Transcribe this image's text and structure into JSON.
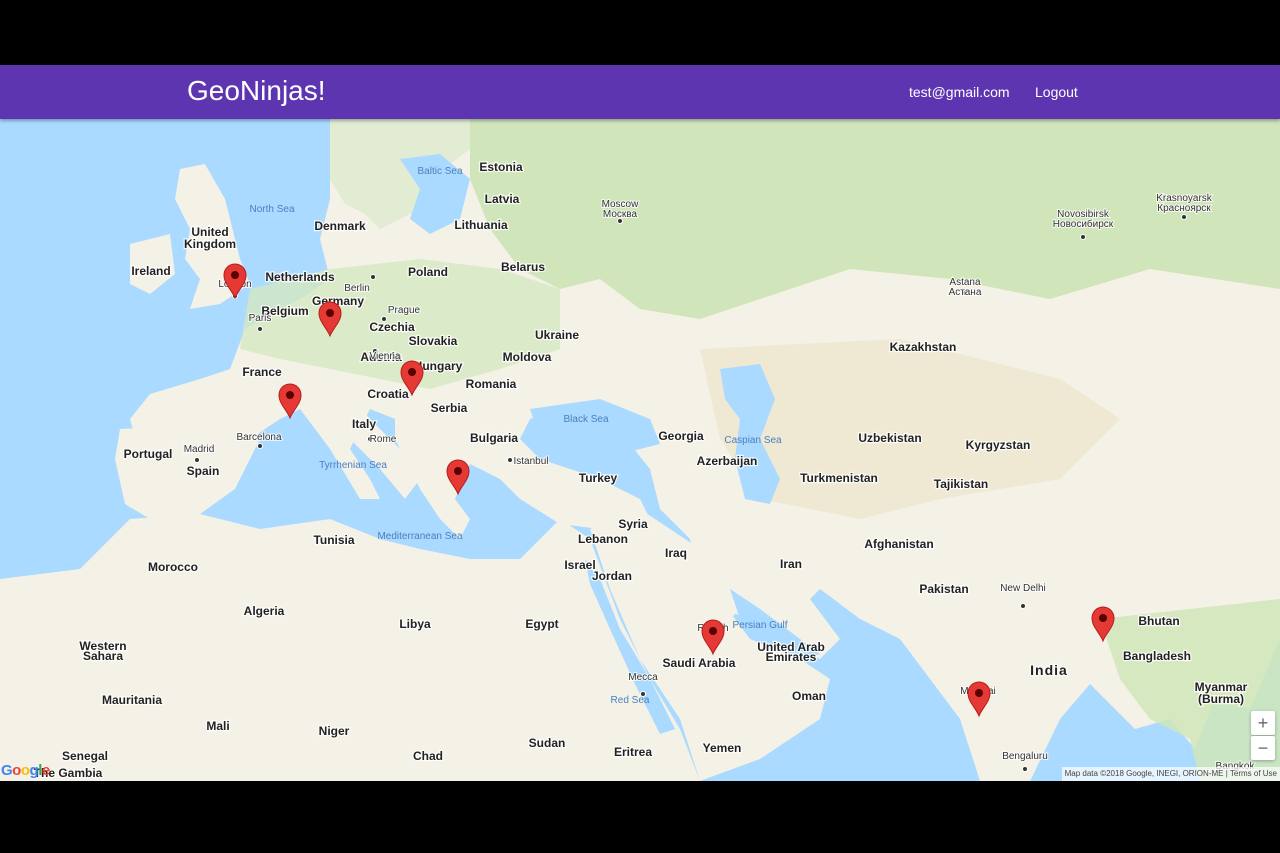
{
  "navbar": {
    "brand": "GeoNinjas!",
    "user_email": "test@gmail.com",
    "logout_label": "Logout",
    "color": "#5e35b1"
  },
  "map": {
    "water_color": "#aadaff",
    "land_color": "#f4f1e6",
    "forest_color": "#c9e3b2",
    "countries": [
      "United Kingdom",
      "Ireland",
      "Netherlands",
      "Belgium",
      "Germany",
      "Czechia",
      "Slovakia",
      "Austria",
      "Hungary",
      "Croatia",
      "Serbia",
      "Romania",
      "Moldova",
      "Bulgaria",
      "France",
      "Italy",
      "Spain",
      "Portugal",
      "Denmark",
      "Poland",
      "Estonia",
      "Latvia",
      "Lithuania",
      "Belarus",
      "Ukraine",
      "Georgia",
      "Azerbaijan",
      "Turkey",
      "Syria",
      "Lebanon",
      "Israel",
      "Jordan",
      "Iraq",
      "Iran",
      "Kazakhstan",
      "Uzbekistan",
      "Kyrgyzstan",
      "Turkmenistan",
      "Tajikistan",
      "Afghanistan",
      "Pakistan",
      "India",
      "Bhutan",
      "Bangladesh",
      "Myanmar (Burma)",
      "Saudi Arabia",
      "United Arab Emirates",
      "Oman",
      "Yemen",
      "Egypt",
      "Libya",
      "Algeria",
      "Tunisia",
      "Morocco",
      "Western Sahara",
      "Mauritania",
      "Mali",
      "Niger",
      "Chad",
      "Sudan",
      "Eritrea",
      "Senegal",
      "The Gambia"
    ],
    "cities": [
      "London",
      "Paris",
      "Berlin",
      "Prague",
      "Vienna",
      "Rome",
      "Madrid",
      "Barcelona",
      "Istanbul",
      "Moscow\nМосква",
      "Novosibirsk\nНовосибирск",
      "Krasnoyarsk\nКрасноярск",
      "Astana\nАстана",
      "Riyadh",
      "Mecca",
      "New Delhi",
      "Mumbai",
      "Bengaluru",
      "Bangkok"
    ],
    "water_bodies": [
      "North Sea",
      "Baltic Sea",
      "Black Sea",
      "Caspian Sea",
      "Tyrrhenian Sea",
      "Mediterranean Sea",
      "Persian Gulf",
      "Red Sea"
    ],
    "markers": [
      {
        "place": "London"
      },
      {
        "place": "Germany"
      },
      {
        "place": "France"
      },
      {
        "place": "Croatia"
      },
      {
        "place": "Greece"
      },
      {
        "place": "Riyadh"
      },
      {
        "place": "Nepal"
      },
      {
        "place": "Mumbai"
      }
    ],
    "marker_color": "#e53935",
    "zoom_in_label": "+",
    "zoom_out_label": "−",
    "attribution": "Map data ©2018 Google, INEGI, ORION-ME",
    "terms_label": "Terms of Use",
    "google_logo": [
      "G",
      "o",
      "o",
      "g",
      "l",
      "e"
    ]
  }
}
